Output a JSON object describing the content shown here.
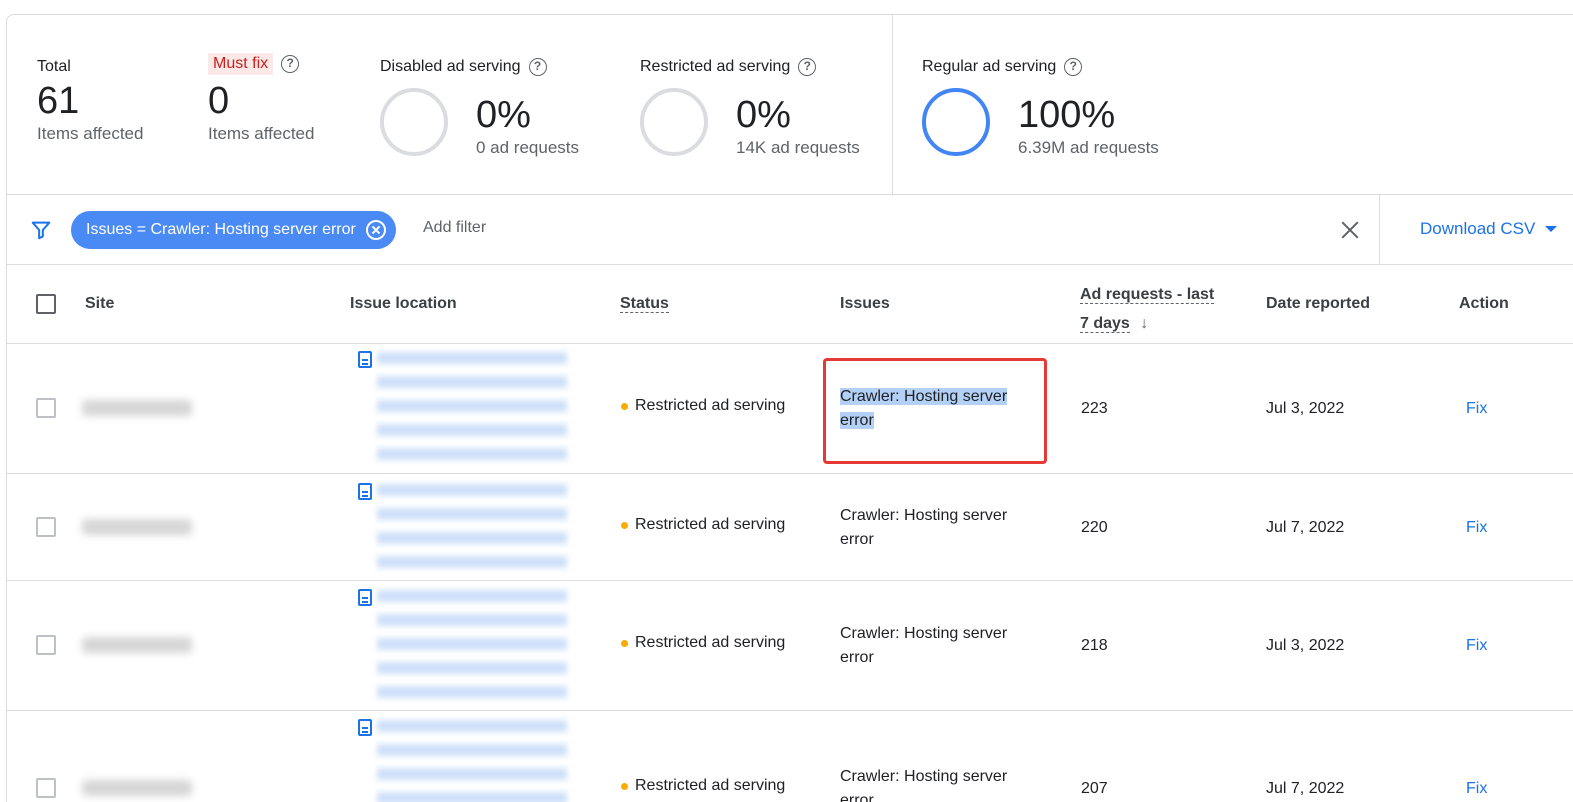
{
  "summary": {
    "total": {
      "label": "Total",
      "value": "61",
      "sub": "Items affected"
    },
    "must_fix": {
      "label": "Must fix",
      "value": "0",
      "sub": "Items affected"
    },
    "disabled": {
      "label": "Disabled ad serving",
      "value": "0%",
      "sub": "0 ad requests"
    },
    "restricted": {
      "label": "Restricted ad serving",
      "value": "0%",
      "sub": "14K ad requests"
    },
    "regular": {
      "label": "Regular ad serving",
      "value": "100%",
      "sub": "6.39M ad requests"
    }
  },
  "filter": {
    "chip": "Issues = Crawler: Hosting server error",
    "add_filter": "Add filter",
    "download": "Download CSV"
  },
  "table": {
    "headers": {
      "site": "Site",
      "location": "Issue location",
      "status": "Status",
      "issues": "Issues",
      "requests_1": "Ad requests - last",
      "requests_2": "7 days",
      "sort": "↓",
      "date": "Date reported",
      "action": "Action"
    },
    "rows": [
      {
        "status": "Restricted ad serving",
        "issue": "Crawler: Hosting server error",
        "requests": "223",
        "date": "Jul 3, 2022",
        "action": "Fix"
      },
      {
        "status": "Restricted ad serving",
        "issue": "Crawler: Hosting server error",
        "requests": "220",
        "date": "Jul 7, 2022",
        "action": "Fix"
      },
      {
        "status": "Restricted ad serving",
        "issue": "Crawler: Hosting server error",
        "requests": "218",
        "date": "Jul 3, 2022",
        "action": "Fix"
      },
      {
        "status": "Restricted ad serving",
        "issue": "Crawler: Hosting server error",
        "requests": "207",
        "date": "Jul 7, 2022",
        "action": "Fix"
      }
    ]
  },
  "colors": {
    "accent": "#1a73e8",
    "chip": "#4a8af4",
    "must_fix": "#c5221f",
    "status_dot": "#f9ab00",
    "highlight_box": "#e53935"
  },
  "icons": [
    "help-icon",
    "filter-icon",
    "close-circle-icon",
    "close-icon",
    "caret-down-icon",
    "arrow-down-icon",
    "document-icon"
  ]
}
